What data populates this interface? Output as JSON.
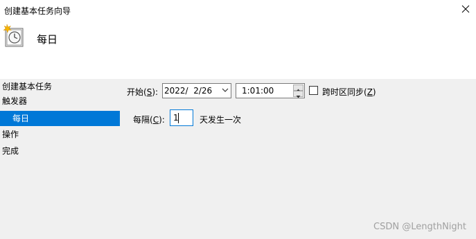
{
  "window": {
    "title": "创建基本任务向导"
  },
  "header": {
    "title": "每日"
  },
  "nav": {
    "items": [
      {
        "label": "创建基本任务"
      },
      {
        "label": "触发器"
      },
      {
        "label": "每日"
      },
      {
        "label": "操作"
      },
      {
        "label": "完成"
      }
    ]
  },
  "trigger": {
    "start_label_prefix": "开始(",
    "start_label_key": "S",
    "start_label_suffix": "):",
    "date_value": "2022/  2/26",
    "time_value": "1:01:00",
    "sync_label_prefix": "跨时区同步(",
    "sync_label_key": "Z",
    "sync_label_suffix": ")",
    "sync_checked": false,
    "interval_label_prefix": "每隔(",
    "interval_label_key": "C",
    "interval_label_suffix": "):",
    "interval_value": "1",
    "interval_unit": "天发生一次"
  },
  "watermark": "CSDN @LengthNight",
  "colors": {
    "selection": "#0078d7",
    "panel_bg": "#f0f0f0"
  }
}
